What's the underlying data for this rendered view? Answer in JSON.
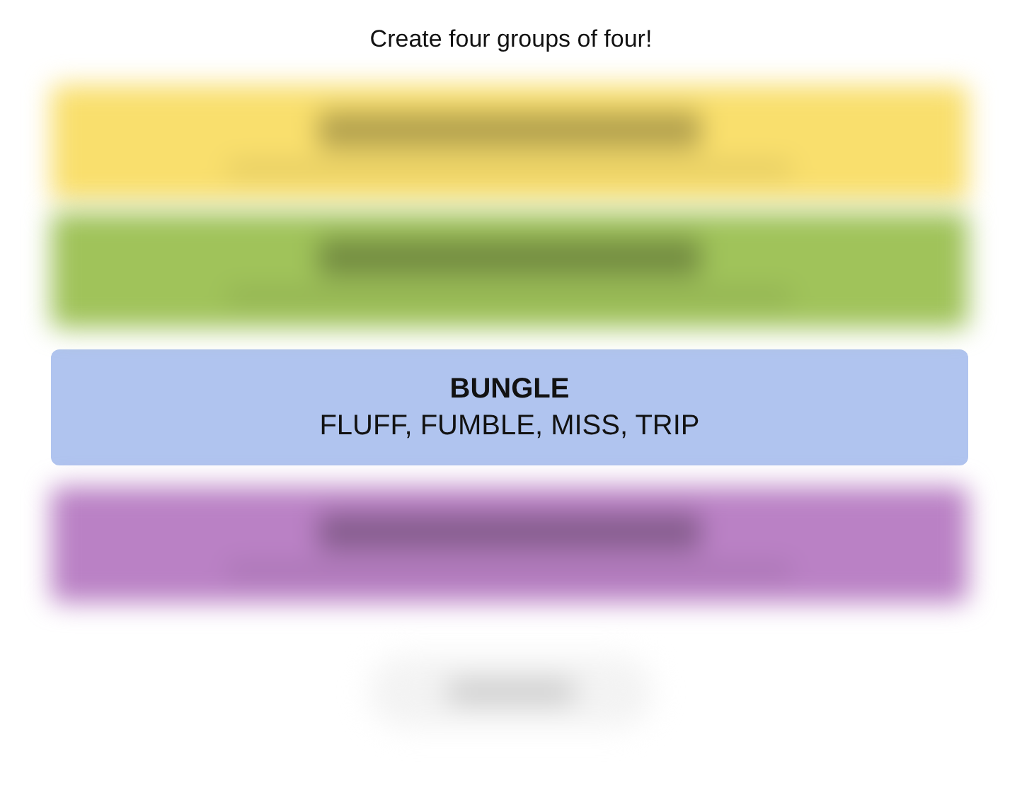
{
  "heading": "Create four groups of four!",
  "groups": [
    {
      "kind": "blurred",
      "color": "#f9df6d"
    },
    {
      "kind": "blurred",
      "color": "#a0c35a"
    },
    {
      "kind": "revealed",
      "color": "#b0c4ef",
      "title": "BUNGLE",
      "members": "FLUFF, FUMBLE, MISS, TRIP"
    },
    {
      "kind": "blurred",
      "color": "#ba81c5"
    }
  ]
}
